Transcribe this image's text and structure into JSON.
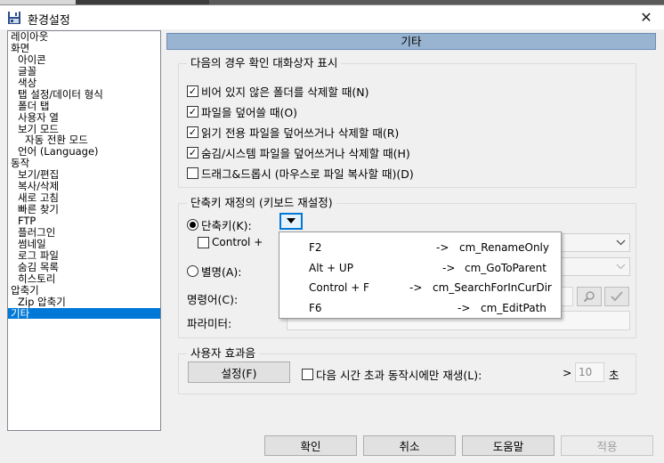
{
  "window": {
    "title": "환경설정",
    "close_glyph": "✕"
  },
  "tree": {
    "items": [
      {
        "label": "레이아웃",
        "level": 0
      },
      {
        "label": "화면",
        "level": 0
      },
      {
        "label": "아이콘",
        "level": 1
      },
      {
        "label": "글꼴",
        "level": 1
      },
      {
        "label": "색상",
        "level": 1
      },
      {
        "label": "탭 설정/데이터 형식",
        "level": 1
      },
      {
        "label": "폴더 탭",
        "level": 1
      },
      {
        "label": "사용자 열",
        "level": 1
      },
      {
        "label": "보기 모드",
        "level": 1
      },
      {
        "label": "자동 전환 모드",
        "level": 2
      },
      {
        "label": "언어 (Language)",
        "level": 1
      },
      {
        "label": "동작",
        "level": 0
      },
      {
        "label": "보기/편집",
        "level": 1
      },
      {
        "label": "복사/삭제",
        "level": 1
      },
      {
        "label": "새로 고침",
        "level": 1
      },
      {
        "label": "빠른 찾기",
        "level": 1
      },
      {
        "label": "FTP",
        "level": 1
      },
      {
        "label": "플러그인",
        "level": 1
      },
      {
        "label": "썸네일",
        "level": 1
      },
      {
        "label": "로그 파일",
        "level": 1
      },
      {
        "label": "숨김 목록",
        "level": 1
      },
      {
        "label": "히스토리",
        "level": 1
      },
      {
        "label": "압축기",
        "level": 0
      },
      {
        "label": "Zip 압축기",
        "level": 1
      },
      {
        "label": "기타",
        "level": 0,
        "selected": true
      }
    ]
  },
  "section": {
    "title": "기타"
  },
  "confirm_group": {
    "title": "다음의 경우 확인 대화상자 표시",
    "options": [
      {
        "label": "비어 있지 않은 폴더를 삭제할 때(N)",
        "checked": true
      },
      {
        "label": "파일을 덮어쓸 때(O)",
        "checked": true
      },
      {
        "label": "읽기 전용 파일을 덮어쓰거나 삭제할 때(R)",
        "checked": true
      },
      {
        "label": "숨김/시스템 파일을 덮어쓰거나 삭제할 때(H)",
        "checked": true
      },
      {
        "label": "드래그&드롭시 (마우스로 파일 복사할 때)(D)",
        "checked": false
      }
    ],
    "check_glyph": "✓"
  },
  "hotkey_group": {
    "title": "단축키 재정의 (키보드 재설정)",
    "shortcut_radio": "단축키(K):",
    "control_checkbox": "Control +",
    "alias_radio": "별명(A):",
    "command_label": "명령어(C):",
    "param_label": "파라미터:"
  },
  "dropdown": {
    "items": [
      {
        "key": "F2",
        "arrow": "->",
        "command": "cm_RenameOnly"
      },
      {
        "key": "Alt + UP",
        "arrow": "->",
        "command": "cm_GoToParent"
      },
      {
        "key": "Control + F",
        "arrow": "->",
        "command": "cm_SearchForInCurDir"
      },
      {
        "key": "F6",
        "arrow": "->",
        "command": "cm_EditPath"
      }
    ]
  },
  "sound_group": {
    "title": "사용자 효과음",
    "setup_button": "설정(F)",
    "play_checkbox": "다음 시간 초과 동작시에만 재생(L):",
    "gt": ">",
    "seconds_value": "10",
    "seconds_unit": "초"
  },
  "footer": {
    "ok": "확인",
    "cancel": "취소",
    "help": "도움말",
    "apply": "적용"
  },
  "colors": {
    "selection": "#0078d7",
    "section_header": "#99b4d1"
  }
}
